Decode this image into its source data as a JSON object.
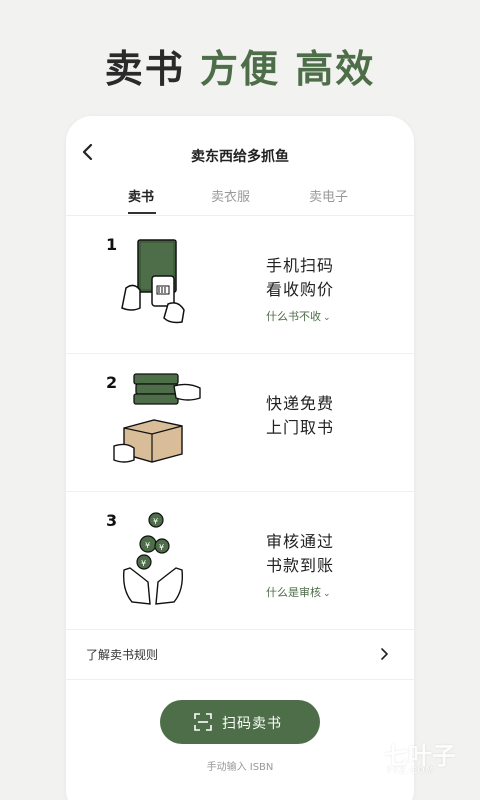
{
  "headline": {
    "part1": "卖书",
    "part2": "方便 高效"
  },
  "nav": {
    "title": "卖东西给多抓鱼"
  },
  "tabs": [
    {
      "label": "卖书",
      "active": true
    },
    {
      "label": "卖衣服",
      "active": false
    },
    {
      "label": "卖电子",
      "active": false
    }
  ],
  "steps": [
    {
      "number": "1",
      "line1": "手机扫码",
      "line2": "看收购价",
      "link": "什么书不收",
      "illustration": "scan-book-illustration"
    },
    {
      "number": "2",
      "line1": "快递免费",
      "line2": "上门取书",
      "link": "",
      "illustration": "box-handoff-illustration"
    },
    {
      "number": "3",
      "line1": "审核通过",
      "line2": "书款到账",
      "link": "什么是审核",
      "illustration": "coins-hands-illustration"
    }
  ],
  "rules": {
    "label": "了解卖书规则"
  },
  "scan_button": {
    "label": "扫码卖书"
  },
  "manual_input": {
    "label": "手动输入 ISBN"
  },
  "watermark": {
    "text": "七叶子",
    "sub": "7YZ.COM"
  },
  "colors": {
    "accent": "#4d6e48",
    "background": "#f2f2f0"
  }
}
